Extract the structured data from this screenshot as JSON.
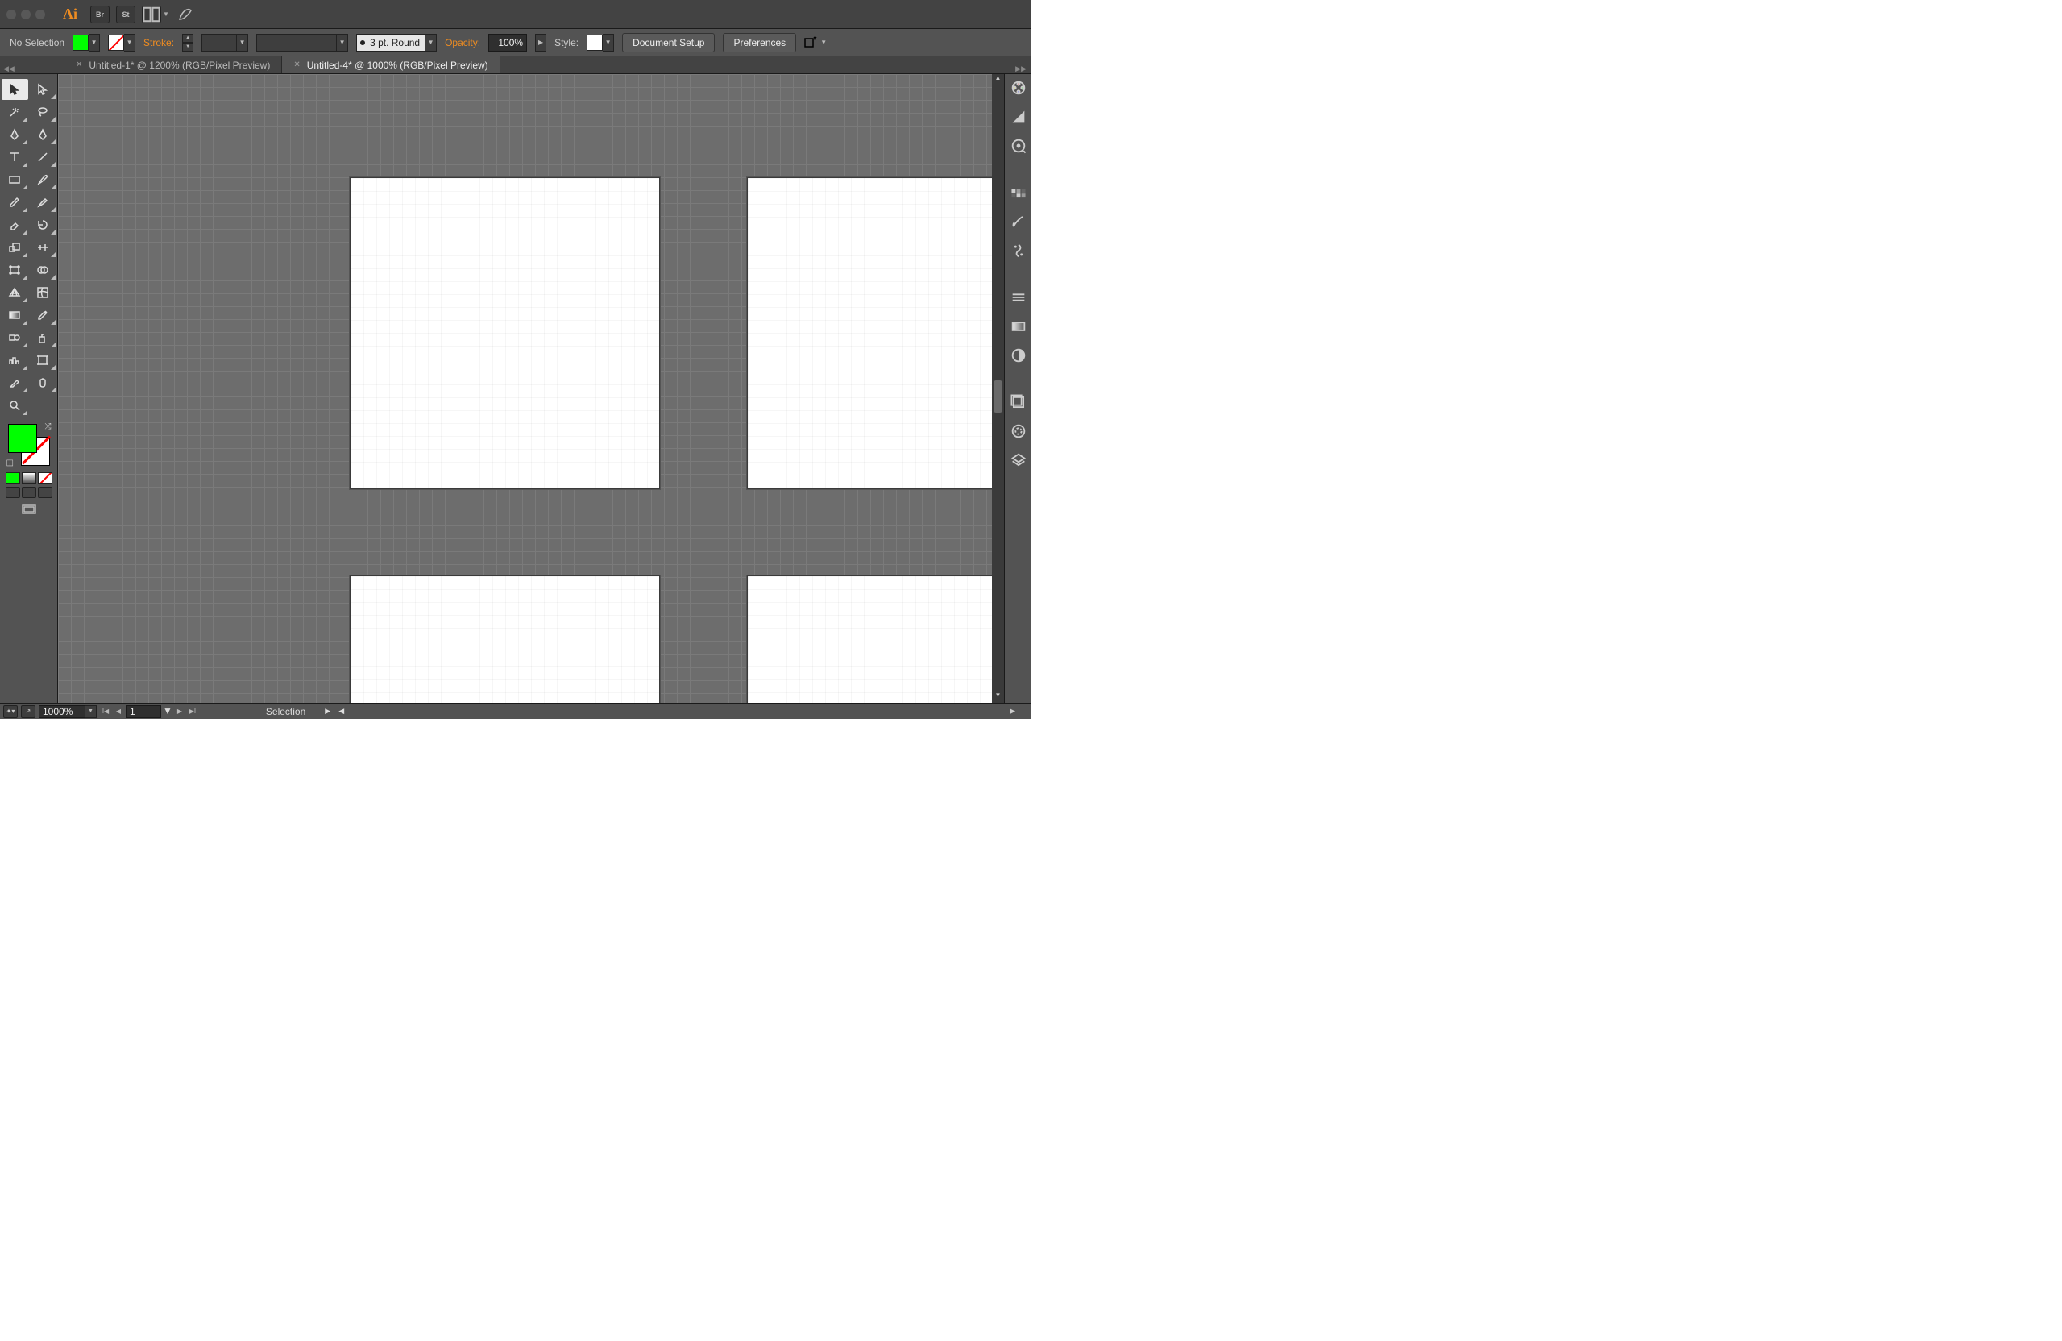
{
  "titlebar": {
    "br_label": "Br",
    "st_label": "St"
  },
  "control": {
    "selection_label": "No Selection",
    "stroke_label": "Stroke:",
    "brush_profile": "3 pt. Round",
    "opacity_label": "Opacity:",
    "opacity_value": "100%",
    "style_label": "Style:",
    "doc_setup": "Document Setup",
    "preferences": "Preferences",
    "fill_color": "#00ff00"
  },
  "tabs": [
    {
      "label": "Untitled-1* @ 1200% (RGB/Pixel Preview)",
      "active": false
    },
    {
      "label": "Untitled-4* @ 1000% (RGB/Pixel Preview)",
      "active": true
    }
  ],
  "status": {
    "zoom": "1000%",
    "artboard_num": "1",
    "tool": "Selection"
  },
  "colors": {
    "fill": "#00ff00",
    "stroke": "none"
  }
}
